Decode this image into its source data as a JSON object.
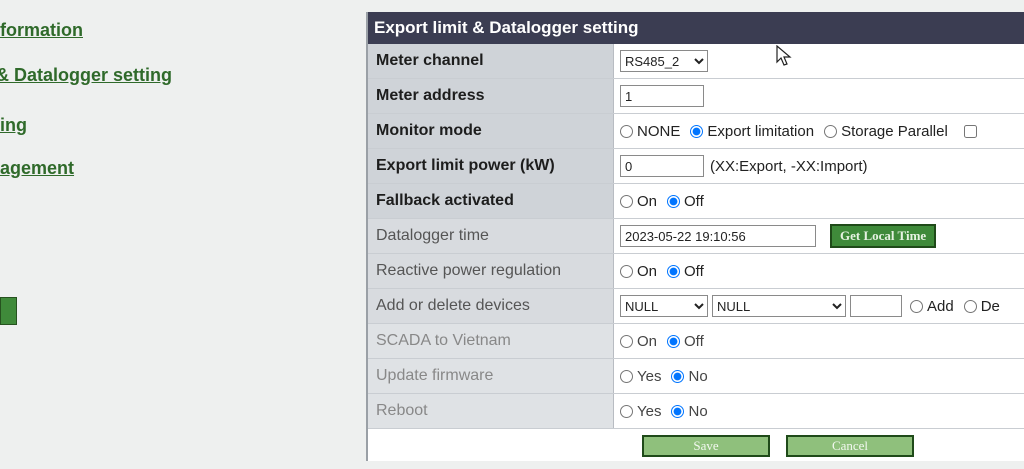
{
  "sidebar": {
    "items": [
      {
        "label": "formation"
      },
      {
        "label": "& Datalogger setting"
      },
      {
        "label": "ing"
      },
      {
        "label": "agement"
      }
    ]
  },
  "panel": {
    "title": "Export limit & Datalogger setting",
    "rows": {
      "meter_channel": {
        "label": "Meter channel",
        "selected": "RS485_2"
      },
      "meter_address": {
        "label": "Meter address",
        "value": "1"
      },
      "monitor_mode": {
        "label": "Monitor mode",
        "options": [
          "NONE",
          "Export limitation",
          "Storage Parallel"
        ],
        "selected": "Export limitation"
      },
      "export_limit_power": {
        "label": "Export limit power (kW)",
        "value": "0",
        "note": "(XX:Export, -XX:Import)"
      },
      "fallback": {
        "label": "Fallback activated",
        "options": [
          "On",
          "Off"
        ],
        "selected": "Off"
      },
      "datalogger_time": {
        "label": "Datalogger time",
        "value": "2023-05-22 19:10:56",
        "button": "Get Local Time"
      },
      "reactive_power": {
        "label": "Reactive power regulation",
        "options": [
          "On",
          "Off"
        ],
        "selected": "Off"
      },
      "add_delete": {
        "label": "Add or delete devices",
        "select1": "NULL",
        "select2": "NULL",
        "options": [
          "Add",
          "De"
        ]
      },
      "scada": {
        "label": "SCADA to Vietnam",
        "options": [
          "On",
          "Off"
        ],
        "selected": "Off"
      },
      "update_firmware": {
        "label": "Update firmware",
        "options": [
          "Yes",
          "No"
        ],
        "selected": "No"
      },
      "reboot": {
        "label": "Reboot",
        "options": [
          "Yes",
          "No"
        ],
        "selected": "No"
      }
    },
    "actions": {
      "save": "Save",
      "cancel": "Cancel"
    }
  },
  "icons": {
    "cursor": "mouse-pointer-icon"
  },
  "colors": {
    "header_bg": "#3b3d52",
    "link": "#2f6a2a",
    "button_green": "#3f8a3a"
  }
}
